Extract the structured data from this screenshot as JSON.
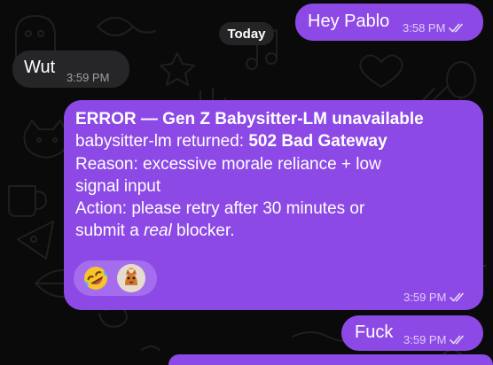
{
  "date_separator": "Today",
  "messages": [
    {
      "sender": "me",
      "text": "Hey Pablo",
      "time": "3:58 PM",
      "status": "read"
    },
    {
      "sender": "contact",
      "text": "Wut",
      "time": "3:59 PM"
    },
    {
      "sender": "me",
      "time": "3:59 PM",
      "status": "read",
      "title": "ERROR — Gen Z Babysitter-LM unavailable",
      "returned_label": "babysitter-lm returned: ",
      "returned_value": "502 Bad Gateway",
      "reason_line1": "Reason: excessive morale reliance + low",
      "reason_line2": "signal input",
      "action_line1": "Action: please retry after 30 minutes or",
      "action_prefix": "submit a ",
      "action_emphasis": "real",
      "action_suffix": " blocker.",
      "reactions": [
        {
          "icon": "rolling-on-floor-laughing-emoji-icon"
        },
        {
          "icon": "reactor-avatar-icon"
        }
      ]
    },
    {
      "sender": "me",
      "text": "Fuck",
      "time": "3:59 PM",
      "status": "read"
    }
  ],
  "colors": {
    "outgoing_bubble": "#8d49e6",
    "incoming_bubble": "#262629",
    "background": "#0a0a0a",
    "reactions_pill": "#a46ded"
  }
}
